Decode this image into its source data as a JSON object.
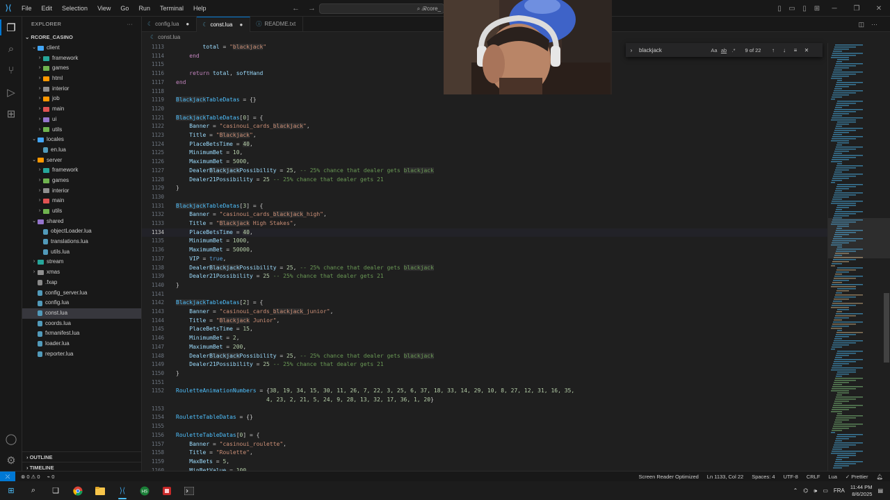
{
  "menu": [
    "File",
    "Edit",
    "Selection",
    "View",
    "Go",
    "Run",
    "Terminal",
    "Help"
  ],
  "command_center": "ℛcore_",
  "explorer": {
    "title": "EXPLORER",
    "root": "RCORE_CASINO",
    "items": [
      {
        "label": "client",
        "depth": 1,
        "type": "folder",
        "open": true,
        "color": "blue"
      },
      {
        "label": "framework",
        "depth": 2,
        "type": "folder",
        "color": "teal"
      },
      {
        "label": "games",
        "depth": 2,
        "type": "folder",
        "color": "green"
      },
      {
        "label": "html",
        "depth": 2,
        "type": "folder",
        "color": "orange"
      },
      {
        "label": "interior",
        "depth": 2,
        "type": "folder",
        "color": "gray"
      },
      {
        "label": "job",
        "depth": 2,
        "type": "folder",
        "color": "orange"
      },
      {
        "label": "main",
        "depth": 2,
        "type": "folder",
        "color": "red"
      },
      {
        "label": "ui",
        "depth": 2,
        "type": "folder",
        "color": "purple"
      },
      {
        "label": "utils",
        "depth": 2,
        "type": "folder",
        "color": "green"
      },
      {
        "label": "locales",
        "depth": 1,
        "type": "folder",
        "open": true,
        "color": "blue"
      },
      {
        "label": "en.lua",
        "depth": 2,
        "type": "file"
      },
      {
        "label": "server",
        "depth": 1,
        "type": "folder",
        "open": true,
        "color": "orange"
      },
      {
        "label": "framework",
        "depth": 2,
        "type": "folder",
        "color": "teal"
      },
      {
        "label": "games",
        "depth": 2,
        "type": "folder",
        "color": "green"
      },
      {
        "label": "interior",
        "depth": 2,
        "type": "folder",
        "color": "gray"
      },
      {
        "label": "main",
        "depth": 2,
        "type": "folder",
        "color": "red"
      },
      {
        "label": "utils",
        "depth": 2,
        "type": "folder",
        "color": "green"
      },
      {
        "label": "shared",
        "depth": 1,
        "type": "folder",
        "open": true,
        "color": "purple"
      },
      {
        "label": "objectLoader.lua",
        "depth": 2,
        "type": "file"
      },
      {
        "label": "translations.lua",
        "depth": 2,
        "type": "file"
      },
      {
        "label": "utils.lua",
        "depth": 2,
        "type": "file"
      },
      {
        "label": "stream",
        "depth": 1,
        "type": "folder",
        "color": "teal"
      },
      {
        "label": "xmas",
        "depth": 1,
        "type": "folder",
        "color": "gray"
      },
      {
        "label": ".fxap",
        "depth": 1,
        "type": "file",
        "git": true
      },
      {
        "label": "config_server.lua",
        "depth": 1,
        "type": "file"
      },
      {
        "label": "config.lua",
        "depth": 1,
        "type": "file"
      },
      {
        "label": "const.lua",
        "depth": 1,
        "type": "file",
        "selected": true
      },
      {
        "label": "coords.lua",
        "depth": 1,
        "type": "file"
      },
      {
        "label": "fxmanifest.lua",
        "depth": 1,
        "type": "file"
      },
      {
        "label": "loader.lua",
        "depth": 1,
        "type": "file"
      },
      {
        "label": "reporter.lua",
        "depth": 1,
        "type": "file"
      }
    ],
    "outline": "OUTLINE",
    "timeline": "TIMELINE"
  },
  "tabs": [
    {
      "label": "config.lua",
      "icon": "lua",
      "state": "dirty"
    },
    {
      "label": "const.lua",
      "icon": "lua",
      "state": "dirty-active"
    },
    {
      "label": "README.txt",
      "icon": "info",
      "state": ""
    }
  ],
  "breadcrumb": "const.lua",
  "find": {
    "query": "blackjack",
    "count": "9 of 22"
  },
  "code_lines": [
    {
      "n": 1113,
      "html": "        <span class=\"id\">total</span> = <span class=\"str\">\"<span class=\"hl\">blackjack</span>\"</span>"
    },
    {
      "n": 1114,
      "html": "    <span class=\"kw\">end</span>"
    },
    {
      "n": 1115,
      "html": ""
    },
    {
      "n": 1116,
      "html": "    <span class=\"kw\">return</span> <span class=\"id\">total</span>, <span class=\"id\">softHand</span>"
    },
    {
      "n": 1117,
      "html": "<span class=\"kw\">end</span>"
    },
    {
      "n": 1118,
      "html": ""
    },
    {
      "n": 1119,
      "html": "<span class=\"gid\"><span class=\"hl\">Blackjack</span>TableDatas</span> = {}"
    },
    {
      "n": 1120,
      "html": ""
    },
    {
      "n": 1121,
      "html": "<span class=\"gid\"><span class=\"hl\">Blackjack</span>TableDatas</span>[<span class=\"num\">0</span>] = {"
    },
    {
      "n": 1122,
      "html": "    <span class=\"id\">Banner</span> = <span class=\"str\">\"casinoui_cards_<span class=\"hl\">blackjack</span>\"</span>,"
    },
    {
      "n": 1123,
      "html": "    <span class=\"id\">Title</span> = <span class=\"str\">\"<span class=\"hl\">Blackjack</span>\"</span>,"
    },
    {
      "n": 1124,
      "html": "    <span class=\"id\">PlaceBetsTime</span> = <span class=\"num hl\">40</span>,"
    },
    {
      "n": 1125,
      "html": "    <span class=\"id\">MinimumBet</span> = <span class=\"num\">10</span>,"
    },
    {
      "n": 1126,
      "html": "    <span class=\"id\">MaximumBet</span> = <span class=\"num\">5000</span>,"
    },
    {
      "n": 1127,
      "html": "    <span class=\"id\">Dealer<span class=\"hl\">Blackjack</span>Possibility</span> = <span class=\"num\">25</span>, <span class=\"cmt\">-- 25% chance that dealer gets <span class=\"hl\">blackjack</span></span>"
    },
    {
      "n": 1128,
      "html": "    <span class=\"id\">Dealer21Possibility</span> = <span class=\"num\">25</span> <span class=\"cmt\">-- 25% chance that dealer gets 21</span>"
    },
    {
      "n": 1129,
      "html": "}"
    },
    {
      "n": 1130,
      "html": ""
    },
    {
      "n": 1131,
      "html": "<span class=\"gid\"><span class=\"hl\">Blackjack</span>TableDatas</span>[<span class=\"num\">3</span>] = {"
    },
    {
      "n": 1132,
      "html": "    <span class=\"id\">Banner</span> = <span class=\"str\">\"casinoui_cards_<span class=\"hl\">blackjack</span>_high\"</span>,"
    },
    {
      "n": 1133,
      "html": "    <span class=\"id\">Title</span> = <span class=\"str\">\"<span class=\"hl\">Blackjack</span> High Stakes\"</span>,"
    },
    {
      "n": 1134,
      "html": "    <span class=\"id\">PlaceBetsTime</span> = <span class=\"num hl\">40</span>,",
      "current": true
    },
    {
      "n": 1135,
      "html": "    <span class=\"id\">MinimumBet</span> = <span class=\"num\">1000</span>,"
    },
    {
      "n": 1136,
      "html": "    <span class=\"id\">MaximumBet</span> = <span class=\"num\">50000</span>,"
    },
    {
      "n": 1137,
      "html": "    <span class=\"id\">VIP</span> = <span class=\"kwb\">true</span>,"
    },
    {
      "n": 1138,
      "html": "    <span class=\"id\">Dealer<span class=\"hl\">Blackjack</span>Possibility</span> = <span class=\"num\">25</span>, <span class=\"cmt\">-- 25% chance that dealer gets <span class=\"hl\">blackjack</span></span>"
    },
    {
      "n": 1139,
      "html": "    <span class=\"id\">Dealer21Possibility</span> = <span class=\"num\">25</span> <span class=\"cmt\">-- 25% chance that dealer gets 21</span>"
    },
    {
      "n": 1140,
      "html": "}"
    },
    {
      "n": 1141,
      "html": ""
    },
    {
      "n": 1142,
      "html": "<span class=\"gid\"><span class=\"hl\">Blackjack</span>TableDatas</span>[<span class=\"num\">2</span>] = {"
    },
    {
      "n": 1143,
      "html": "    <span class=\"id\">Banner</span> = <span class=\"str\">\"casinoui_cards_<span class=\"hl\">blackjack</span>_junior\"</span>,"
    },
    {
      "n": 1144,
      "html": "    <span class=\"id\">Title</span> = <span class=\"str\">\"<span class=\"hl\">Blackjack</span> Junior\"</span>,"
    },
    {
      "n": 1145,
      "html": "    <span class=\"id\">PlaceBetsTime</span> = <span class=\"num\">15</span>,"
    },
    {
      "n": 1146,
      "html": "    <span class=\"id\">MinimumBet</span> = <span class=\"num\">2</span>,"
    },
    {
      "n": 1147,
      "html": "    <span class=\"id\">MaximumBet</span> = <span class=\"num\">200</span>,"
    },
    {
      "n": 1148,
      "html": "    <span class=\"id\">Dealer<span class=\"hl\">Blackjack</span>Possibility</span> = <span class=\"num\">25</span>, <span class=\"cmt\">-- 25% chance that dealer gets <span class=\"hl\">blackjack</span></span>"
    },
    {
      "n": 1149,
      "html": "    <span class=\"id\">Dealer21Possibility</span> = <span class=\"num\">25</span> <span class=\"cmt\">-- 25% chance that dealer gets 21</span>"
    },
    {
      "n": 1150,
      "html": "}"
    },
    {
      "n": 1151,
      "html": ""
    },
    {
      "n": 1152,
      "html": "<span class=\"gid\">RouletteAnimationNumbers</span> = {<span class=\"num\">38, 19, 34, 15, 30, 11, 26, 7, 22, 3, 25, 6, 37, 18, 33, 14, 29, 10, 8, 27, 12, 31, 16, 35,</span>"
    },
    {
      "n": null,
      "html": "                           <span class=\"num\">4, 23, 2, 21, 5, 24, 9, 28, 13, 32, 17, 36, 1, 20</span>}"
    },
    {
      "n": 1153,
      "html": ""
    },
    {
      "n": 1154,
      "html": "<span class=\"gid\">RouletteTableDatas</span> = {}"
    },
    {
      "n": 1155,
      "html": ""
    },
    {
      "n": 1156,
      "html": "<span class=\"gid\">RouletteTableDatas</span>[<span class=\"num\">0</span>] = {"
    },
    {
      "n": 1157,
      "html": "    <span class=\"id\">Banner</span> = <span class=\"str\">\"casinoui_roulette\"</span>,"
    },
    {
      "n": 1158,
      "html": "    <span class=\"id\">Title</span> = <span class=\"str\">\"Roulette\"</span>,"
    },
    {
      "n": 1159,
      "html": "    <span class=\"id\">MaxBets</span> = <span class=\"num\">5</span>,"
    },
    {
      "n": 1160,
      "html": "    <span class=\"id\">MinBetValue</span> = <span class=\"num\">100</span>,"
    }
  ],
  "statusbar": {
    "errors": "⊗ 0  ⚠ 0",
    "ports": "⌁ 0",
    "screen_reader": "Screen Reader Optimized",
    "position": "Ln 1133, Col 22",
    "spaces": "Spaces: 4",
    "encoding": "UTF-8",
    "eol": "CRLF",
    "language": "Lua",
    "formatter": "✓ Prettier"
  },
  "taskbar": {
    "lang": "FRA",
    "time": "11:44 PM",
    "date": "8/6/2025"
  }
}
